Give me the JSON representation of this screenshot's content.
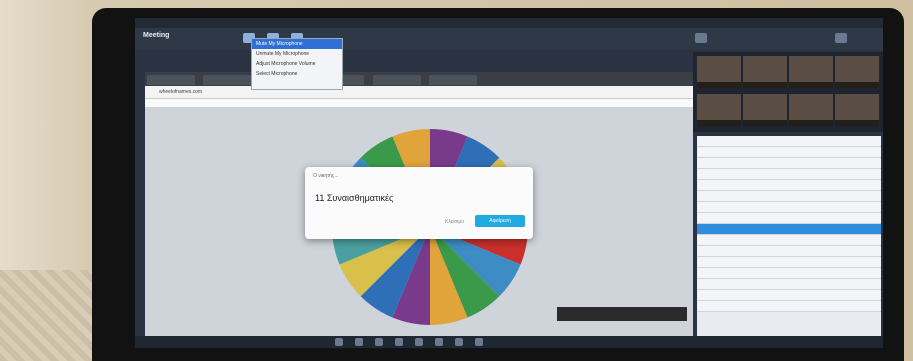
{
  "toolbar": {
    "app": "Meeting"
  },
  "mic_menu": {
    "items": [
      "Mute My Microphone",
      "Unmute My Microphone",
      "",
      "Adjust Microphone Volume",
      "Select Microphone"
    ]
  },
  "browser": {
    "url": "wheelofnames.com"
  },
  "dialog": {
    "title": "Ο νικητής...",
    "winner": "11 Συναισθηματικές",
    "close": "Κλείσιμο",
    "confirm": "Αφαίρεση"
  },
  "wheel_colors": [
    "#c9302c",
    "#3d8cc4",
    "#3a9a4a",
    "#e0a43a",
    "#7a3a8c",
    "#2f6fb8",
    "#d9c04a",
    "#4aa0a0"
  ]
}
